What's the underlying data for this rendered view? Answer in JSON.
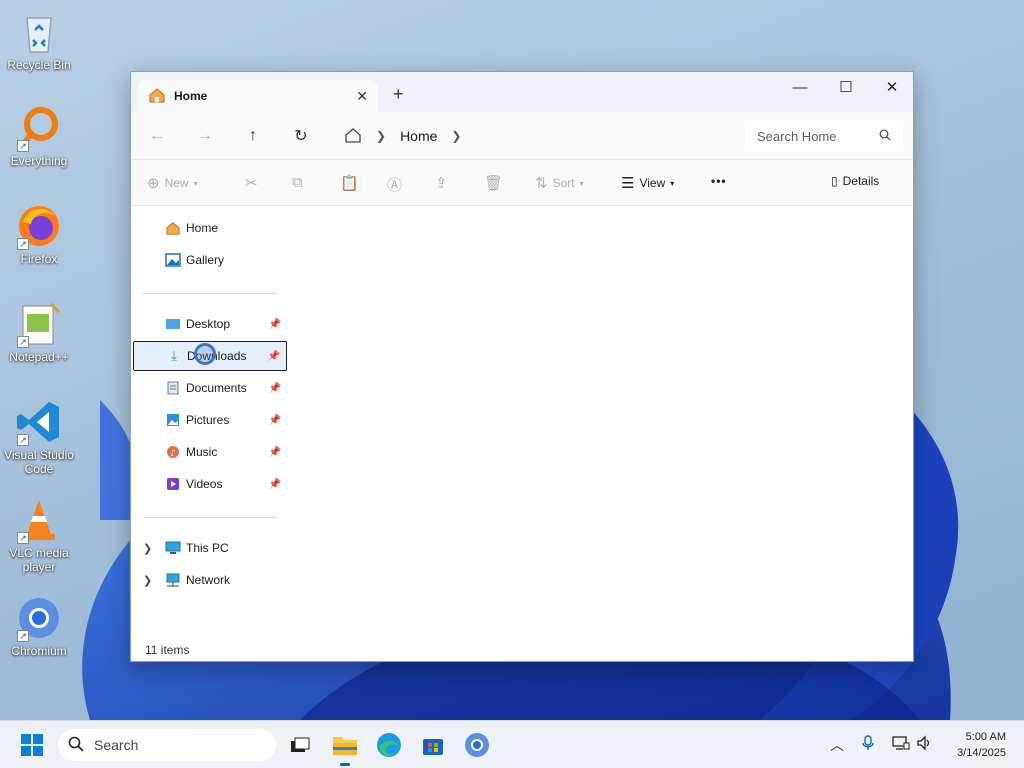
{
  "desktop": {
    "icons": [
      {
        "label": "Recycle Bin",
        "icon": "recycle-bin-icon"
      },
      {
        "label": "Everything",
        "icon": "everything-search-icon"
      },
      {
        "label": "Firefox",
        "icon": "firefox-icon"
      },
      {
        "label": "Notepad++",
        "icon": "notepadpp-icon"
      },
      {
        "label": "Visual Studio Code",
        "icon": "vscode-icon"
      },
      {
        "label": "VLC media player",
        "icon": "vlc-icon"
      },
      {
        "label": "Chromium",
        "icon": "chromium-icon"
      }
    ]
  },
  "window": {
    "tab_title": "Home",
    "new_tab": "+",
    "address": {
      "root_icon": "home-icon",
      "crumb": "Home"
    },
    "search_placeholder": "Search Home",
    "commands": {
      "new": "New",
      "sort": "Sort",
      "view": "View",
      "more": "•••",
      "details": "Details"
    },
    "nav": {
      "home": "Home",
      "gallery": "Gallery",
      "desktop": "Desktop",
      "downloads": "Downloads",
      "documents": "Documents",
      "pictures": "Pictures",
      "music": "Music",
      "videos": "Videos",
      "this_pc": "This PC",
      "network": "Network"
    },
    "status": "11 items"
  },
  "taskbar": {
    "search_label": "Search",
    "time": "5:00 AM",
    "date": "3/14/2025"
  },
  "colors": {
    "accent": "#0067c0",
    "selection_bg": "#e5eefa",
    "wallpaper_blue": "#1f4fd1"
  }
}
